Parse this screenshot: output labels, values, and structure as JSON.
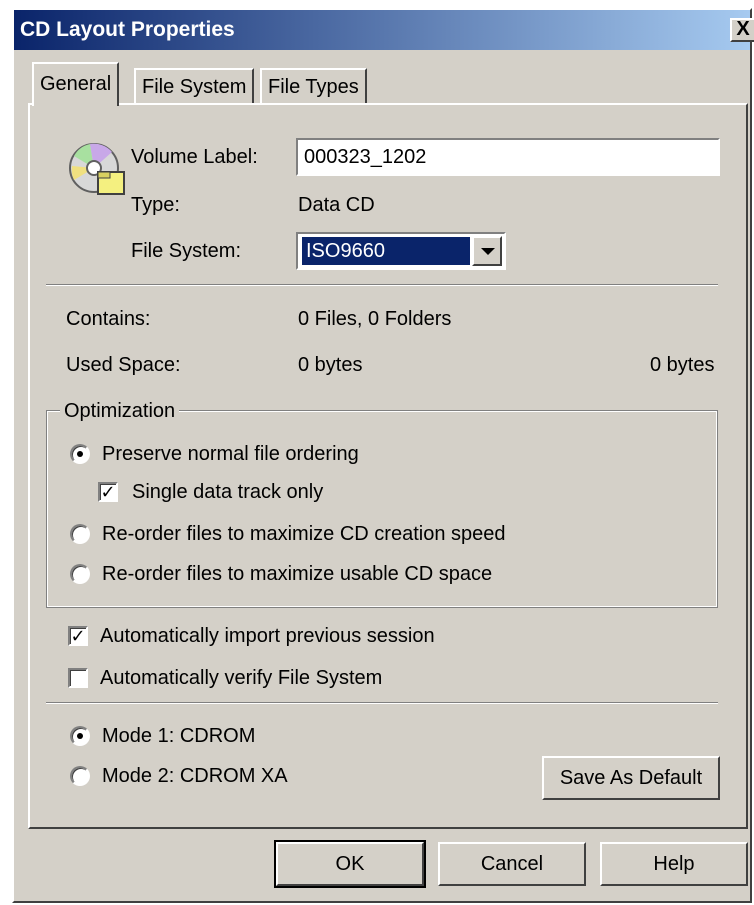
{
  "window": {
    "title": "CD Layout Properties",
    "close_glyph": "X"
  },
  "tabs": [
    {
      "label": "General",
      "active": true
    },
    {
      "label": "File System",
      "active": false
    },
    {
      "label": "File Types",
      "active": false
    }
  ],
  "general": {
    "icon": "cd-icon",
    "volume_label_caption": "Volume Label:",
    "volume_label_value": "000323_1202",
    "type_caption": "Type:",
    "type_value": "Data CD",
    "file_system_caption": "File System:",
    "file_system_value": "ISO9660"
  },
  "stats": {
    "contains_caption": "Contains:",
    "contains_value": "0 Files, 0 Folders",
    "used_space_caption": "Used Space:",
    "used_space_value": "0 bytes",
    "total_space_value": "0 bytes"
  },
  "optimization": {
    "title": "Optimization",
    "options": [
      {
        "label": "Preserve normal  file ordering",
        "selected": true
      },
      {
        "label": "Re-order files to maximize CD creation speed",
        "selected": false
      },
      {
        "label": "Re-order files to maximize usable CD space",
        "selected": false
      }
    ],
    "single_track_label": "Single data track only",
    "single_track_checked": true
  },
  "session": {
    "import_label": "Automatically import previous session",
    "import_checked": true,
    "verify_label": "Automatically verify File System",
    "verify_checked": false
  },
  "mode": {
    "options": [
      {
        "label": "Mode 1: CDROM",
        "selected": true
      },
      {
        "label": "Mode 2: CDROM XA",
        "selected": false
      }
    ],
    "save_default_label": "Save As Default"
  },
  "footer": {
    "ok_label": "OK",
    "cancel_label": "Cancel",
    "help_label": "Help"
  },
  "colors": {
    "title_bar_start": "#0a246a",
    "title_bar_end": "#a6caf0",
    "face": "#d4d0c8",
    "selection": "#0a246a"
  }
}
